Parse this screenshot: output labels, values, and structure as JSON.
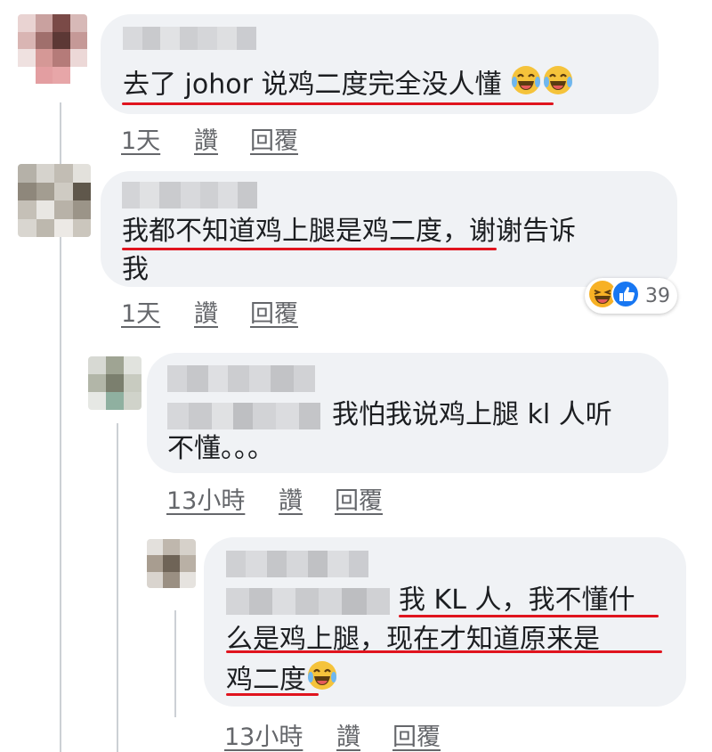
{
  "comments": [
    {
      "text": "去了 johor 说鸡二度完全没人懂",
      "time": "1天",
      "like": "讚",
      "reply": "回覆"
    },
    {
      "text_line1": "我都不知道鸡上腿是鸡二度，谢谢告诉",
      "text_line2": "我",
      "time": "1天",
      "like": "讚",
      "reply": "回覆",
      "reaction_count": "39"
    },
    {
      "text_line1": "我怕我说鸡上腿 kl 人听",
      "text_line2": "不懂。。。",
      "time": "13小時",
      "like": "讚",
      "reply": "回覆"
    },
    {
      "text_line1": "我 KL 人，我不懂什",
      "text_line2": "么是鸡上腿，现在才知道原来是",
      "text_line3": "鸡二度",
      "time": "13小時",
      "like": "讚",
      "reply": "回覆"
    }
  ],
  "icons": {
    "laugh": "laughing-tears-emoji",
    "haha_reaction": "haha-reaction-icon",
    "like_reaction": "thumbs-up-reaction-icon"
  },
  "colors": {
    "bubble": "#f0f2f5",
    "underline": "#e0141e",
    "meta": "#65676b",
    "like_blue": "#1877f2"
  }
}
